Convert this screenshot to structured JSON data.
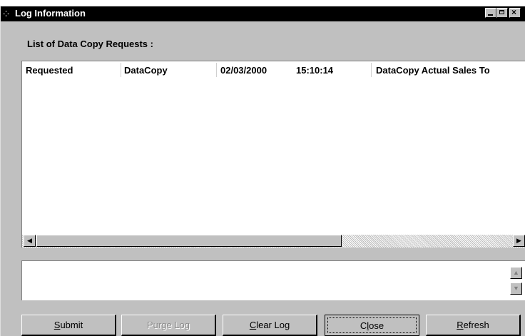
{
  "window": {
    "title": "Log Information"
  },
  "list": {
    "label": "List of Data Copy Requests :",
    "row": {
      "status": "Requested",
      "type": "DataCopy",
      "date": "02/03/2000",
      "time": "15:10:14",
      "description": "DataCopy Actual Sales To"
    },
    "scroll_left_glyph": "◀",
    "scroll_right_glyph": "▶"
  },
  "message_box": {
    "value": "",
    "scroll_up_glyph": "▲",
    "scroll_down_glyph": "▼"
  },
  "buttons": {
    "submit": {
      "pre": "",
      "key": "S",
      "post": "ubmit"
    },
    "purge": {
      "label": "Purge Log",
      "enabled": false
    },
    "clear": {
      "pre": "",
      "key": "C",
      "post": "lear Log"
    },
    "close": {
      "pre": "C",
      "key": "l",
      "post": "ose"
    },
    "refresh": {
      "pre": "",
      "key": "R",
      "post": "efresh"
    }
  },
  "icons": {
    "app": "app-icon",
    "minimize": "minimize-icon",
    "maximize": "maximize-icon",
    "close": "close-icon"
  }
}
